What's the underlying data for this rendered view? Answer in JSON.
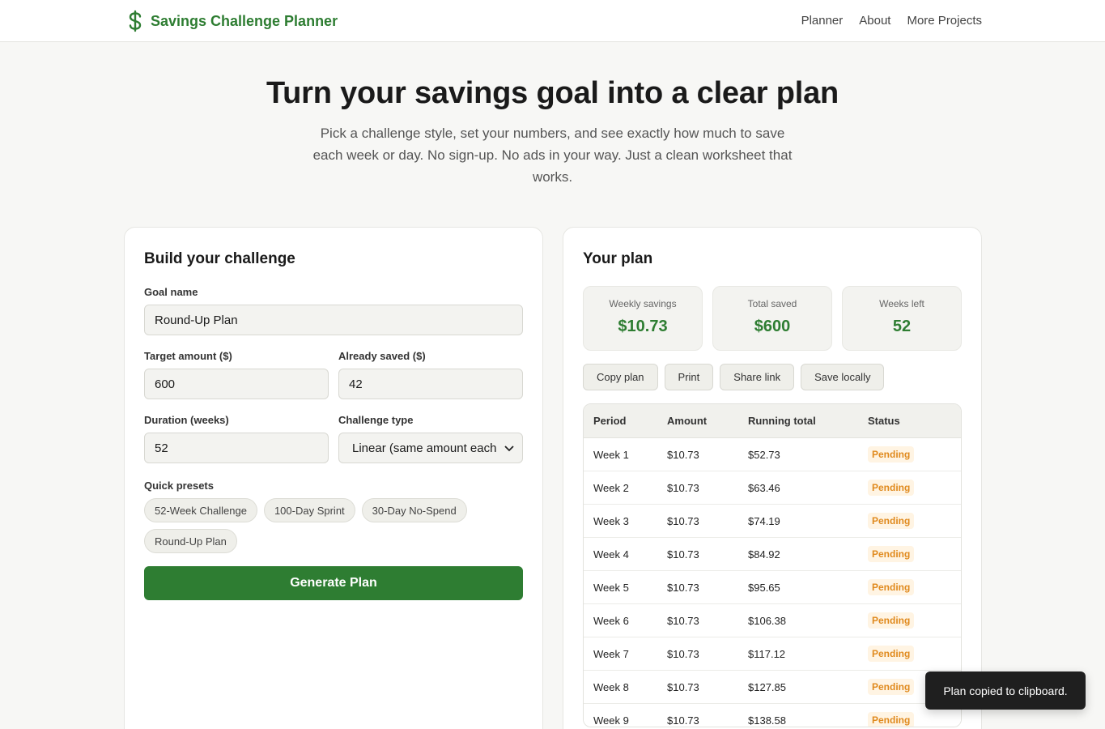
{
  "header": {
    "brand": "Savings Challenge Planner",
    "nav": [
      "Planner",
      "About",
      "More Projects"
    ]
  },
  "hero": {
    "title": "Turn your savings goal into a clear plan",
    "subtitle": "Pick a challenge style, set your numbers, and see exactly how much to save each week or day. No sign-up. No ads in your way. Just a clean worksheet that works."
  },
  "builder": {
    "title": "Build your challenge",
    "goal_label": "Goal name",
    "goal_value": "Round-Up Plan",
    "target_label": "Target amount ($)",
    "target_value": "600",
    "saved_label": "Already saved ($)",
    "saved_value": "42",
    "duration_label": "Duration (weeks)",
    "duration_value": "52",
    "type_label": "Challenge type",
    "type_value": "Linear (same amount each",
    "presets_label": "Quick presets",
    "presets": [
      "52-Week Challenge",
      "100-Day Sprint",
      "30-Day No-Spend",
      "Round-Up Plan"
    ],
    "generate": "Generate Plan"
  },
  "plan": {
    "title": "Your plan",
    "stats": [
      {
        "label": "Weekly savings",
        "value": "$10.73"
      },
      {
        "label": "Total saved",
        "value": "$600"
      },
      {
        "label": "Weeks left",
        "value": "52"
      }
    ],
    "actions": [
      "Copy plan",
      "Print",
      "Share link",
      "Save locally"
    ],
    "columns": [
      "Period",
      "Amount",
      "Running total",
      "Status"
    ],
    "rows": [
      {
        "period": "Week 1",
        "amount": "$10.73",
        "total": "$52.73",
        "status": "Pending"
      },
      {
        "period": "Week 2",
        "amount": "$10.73",
        "total": "$63.46",
        "status": "Pending"
      },
      {
        "period": "Week 3",
        "amount": "$10.73",
        "total": "$74.19",
        "status": "Pending"
      },
      {
        "period": "Week 4",
        "amount": "$10.73",
        "total": "$84.92",
        "status": "Pending"
      },
      {
        "period": "Week 5",
        "amount": "$10.73",
        "total": "$95.65",
        "status": "Pending"
      },
      {
        "period": "Week 6",
        "amount": "$10.73",
        "total": "$106.38",
        "status": "Pending"
      },
      {
        "period": "Week 7",
        "amount": "$10.73",
        "total": "$117.12",
        "status": "Pending"
      },
      {
        "period": "Week 8",
        "amount": "$10.73",
        "total": "$127.85",
        "status": "Pending"
      },
      {
        "period": "Week 9",
        "amount": "$10.73",
        "total": "$138.58",
        "status": "Pending"
      }
    ]
  },
  "toast": "Plan copied to clipboard.",
  "colors": {
    "brand": "#2e7d32",
    "pending": "#e08a1e"
  }
}
